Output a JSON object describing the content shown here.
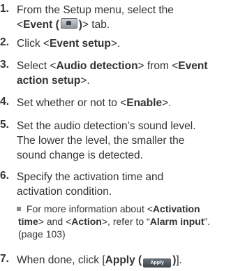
{
  "steps": [
    {
      "num": "1.",
      "l1": "From the Setup menu, select the",
      "l2_pre": "<",
      "l2_b": "Event (",
      "l2_b2": ")",
      "l2_post": "> tab.",
      "icon": "event-tab-icon"
    },
    {
      "num": "2.",
      "pre": "Click <",
      "b": "Event setup",
      "post": ">."
    },
    {
      "num": "3.",
      "pre": "Select <",
      "b": "Audio detection",
      "mid": "> from <",
      "b2": "Event",
      "l2_b": "action setup",
      "l2_post": ">."
    },
    {
      "num": "4.",
      "pre": "Set whether or not to <",
      "b": "Enable",
      "post": ">."
    },
    {
      "num": "5.",
      "lines": [
        "Set the audio detection’s sound level.",
        "The lower the level, the smaller the",
        "sound change is detected."
      ]
    },
    {
      "num": "6.",
      "lines": [
        "Specify the activation time and",
        "activation condition."
      ]
    },
    {
      "num": "7.",
      "pre": "When done, click [",
      "b": "Apply (",
      "b2": ")",
      "post": "].",
      "icon_label": "Apply"
    }
  ],
  "note": {
    "l1_pre": "For more information about <",
    "l1_b": "Activation",
    "l2_b": "time",
    "l2_mid": "> and <",
    "l2_b2": "Action",
    "l2_mid2": ">, refer to “",
    "l2_b3": "Alarm input",
    "l2_post": "”.",
    "l3": "(page 103)"
  }
}
